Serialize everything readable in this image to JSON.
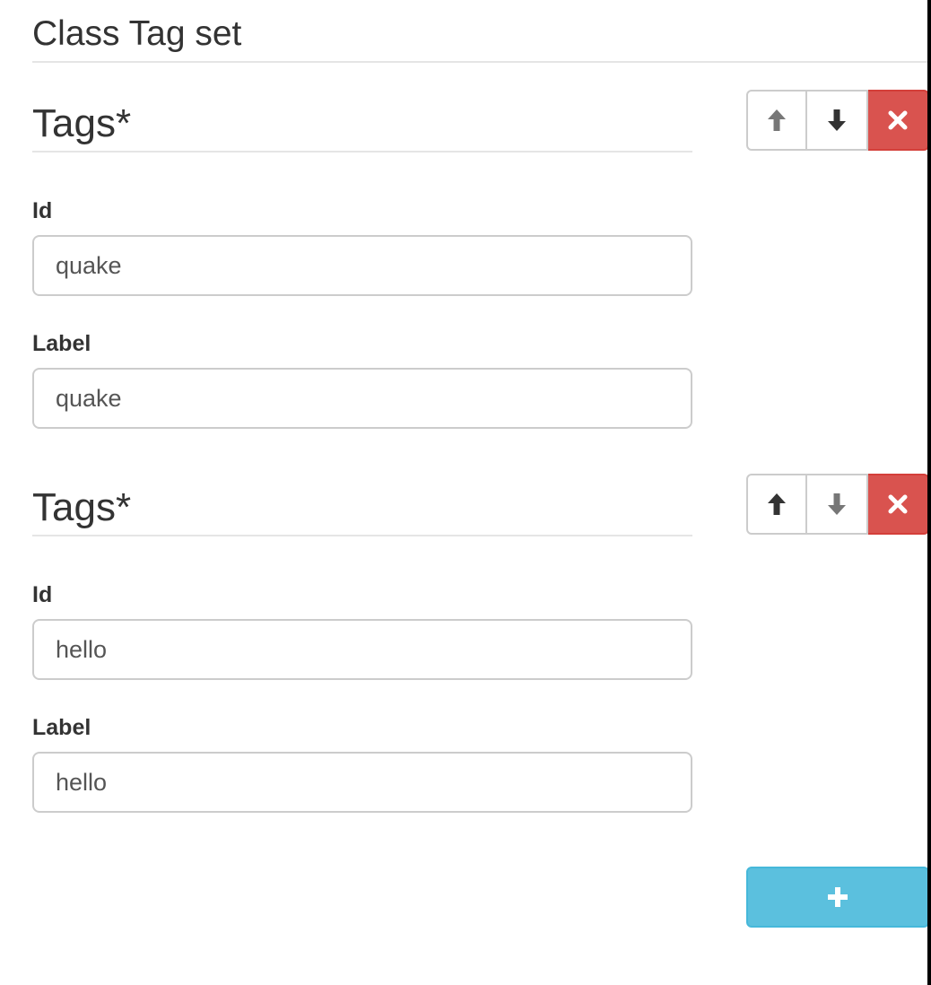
{
  "form": {
    "title": "Class Tag set"
  },
  "tags": [
    {
      "heading": "Tags*",
      "fields": {
        "id_label": "Id",
        "id_value": "quake",
        "label_label": "Label",
        "label_value": "quake"
      },
      "controls": {
        "move_up_enabled": false,
        "move_down_enabled": true
      }
    },
    {
      "heading": "Tags*",
      "fields": {
        "id_label": "Id",
        "id_value": "hello",
        "label_label": "Label",
        "label_value": "hello"
      },
      "controls": {
        "move_up_enabled": true,
        "move_down_enabled": false
      }
    }
  ],
  "icons": {
    "move_up": "arrow-up-icon",
    "move_down": "arrow-down-icon",
    "remove": "close-icon",
    "add": "plus-icon"
  },
  "colors": {
    "danger": "#d9534f",
    "info": "#5bc0de",
    "icon_enabled": "#333333",
    "icon_disabled": "#777777"
  }
}
